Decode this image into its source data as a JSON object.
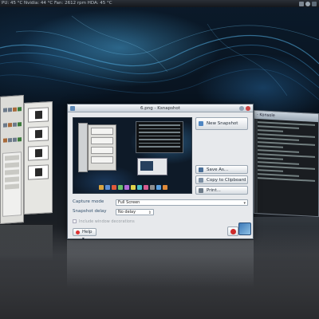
{
  "statusbar": {
    "text": "PU: 45 °C    Nvidia: 44 °C    Fan: 2612 rpm    HDA: 45 °C"
  },
  "ksnapshot": {
    "title": "6.png - Ksnapshot",
    "buttons": {
      "new_snapshot": "New Snapshot",
      "save_as": "Save As...",
      "copy": "Copy to Clipboard",
      "print": "Print..."
    },
    "capture_mode": {
      "label": "Capture mode",
      "value": "Full Screen"
    },
    "snapshot_delay": {
      "label": "Snapshot delay",
      "value": "No delay"
    },
    "include_decorations": "Include window decorations",
    "help_label": "Help",
    "help_arrow": "▾"
  },
  "terminal_window": {
    "title": "- Konsole"
  },
  "colors": {
    "accent": "#5c88b6",
    "close": "#cc2a2a",
    "label_blue": "#33506c"
  },
  "dock_icon_colors": [
    "#d9a441",
    "#5b8fd6",
    "#e05a3a",
    "#6ac26a",
    "#b16ad6",
    "#e0d24a",
    "#4ac0c7",
    "#d65b8f",
    "#8f8f8f",
    "#5aa0e0",
    "#e08a3a"
  ]
}
